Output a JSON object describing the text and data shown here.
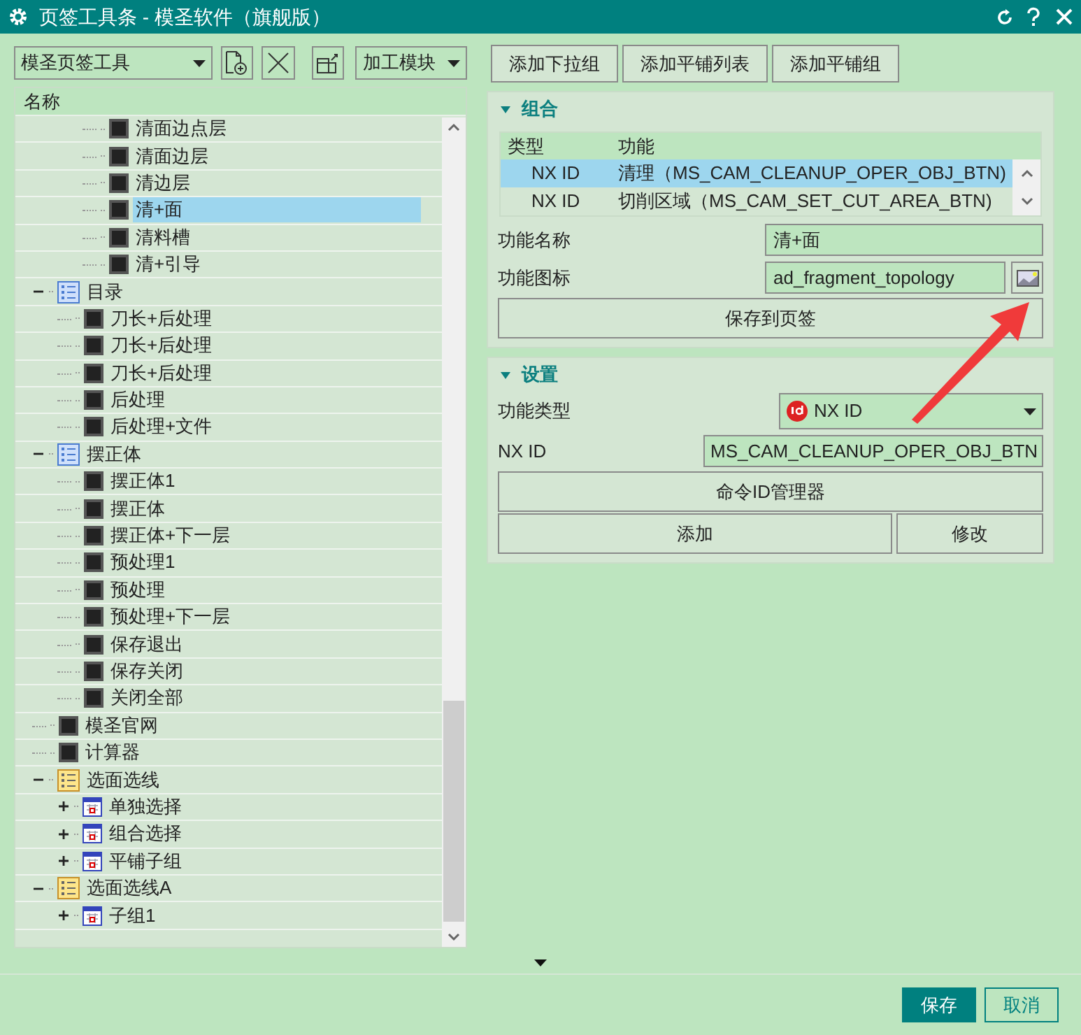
{
  "window": {
    "title": "页签工具条 - 模圣软件（旗舰版）"
  },
  "toolbar": {
    "tab_select": "模圣页签工具",
    "module_select": "加工模块"
  },
  "tree": {
    "column": "名称",
    "partial_branch": [
      {
        "label": "清面边点层",
        "kind": "command",
        "selected": false
      },
      {
        "label": "清面边层",
        "kind": "command",
        "selected": false
      },
      {
        "label": "清边层",
        "kind": "command",
        "selected": false
      },
      {
        "label": "清+面",
        "kind": "command",
        "selected": true
      },
      {
        "label": "清料槽",
        "kind": "command",
        "selected": false
      },
      {
        "label": "清+引导",
        "kind": "command",
        "selected": false
      }
    ],
    "nodes": [
      {
        "label": "目录",
        "kind": "folder",
        "expanded": true,
        "selected": false,
        "children": [
          {
            "label": "刀长+后处理",
            "kind": "command",
            "selected": false
          },
          {
            "label": "刀长+后处理",
            "kind": "command",
            "selected": false
          },
          {
            "label": "刀长+后处理",
            "kind": "command",
            "selected": false
          },
          {
            "label": "后处理",
            "kind": "command",
            "selected": false
          },
          {
            "label": "后处理+文件",
            "kind": "command",
            "selected": false
          }
        ]
      },
      {
        "label": "摆正体",
        "kind": "folder",
        "expanded": true,
        "selected": false,
        "children": [
          {
            "label": "摆正体1",
            "kind": "command",
            "selected": false
          },
          {
            "label": "摆正体",
            "kind": "command",
            "selected": false
          },
          {
            "label": "摆正体+下一层",
            "kind": "command",
            "selected": false
          },
          {
            "label": "预处理1",
            "kind": "command",
            "selected": false
          },
          {
            "label": "预处理",
            "kind": "command",
            "selected": false
          },
          {
            "label": "预处理+下一层",
            "kind": "command",
            "selected": false
          },
          {
            "label": "保存退出",
            "kind": "command",
            "selected": false
          },
          {
            "label": "保存关闭",
            "kind": "command",
            "selected": false
          },
          {
            "label": "关闭全部",
            "kind": "command",
            "selected": false
          }
        ]
      },
      {
        "label": "模圣官网",
        "kind": "command",
        "selected": false
      },
      {
        "label": "计算器",
        "kind": "command",
        "selected": false
      },
      {
        "label": "选面选线",
        "kind": "group",
        "expanded": true,
        "selected": false,
        "children": [
          {
            "label": "单独选择",
            "kind": "subgroup",
            "expanded": false,
            "selected": false
          },
          {
            "label": "组合选择",
            "kind": "subgroup",
            "expanded": false,
            "selected": false
          },
          {
            "label": "平铺子组",
            "kind": "subgroup",
            "expanded": false,
            "selected": false
          }
        ]
      },
      {
        "label": "选面选线A",
        "kind": "group",
        "expanded": true,
        "selected": false,
        "children": [
          {
            "label": "子组1",
            "kind": "subgroup",
            "expanded": false,
            "selected": false
          }
        ]
      }
    ]
  },
  "add_buttons": [
    "添加下拉组",
    "添加平铺列表",
    "添加平铺组"
  ],
  "combo": {
    "title": "组合",
    "expanded": true,
    "columns": [
      "类型",
      "功能"
    ],
    "rows": [
      {
        "type": "NX ID",
        "function": "清理（MS_CAM_CLEANUP_OPER_OBJ_BTN)",
        "selected": true
      },
      {
        "type": "NX ID",
        "function": "切削区域（MS_CAM_SET_CUT_AREA_BTN)",
        "selected": false
      }
    ],
    "name_label": "功能名称",
    "name_value": "清+面",
    "icon_label": "功能图标",
    "icon_value": "ad_fragment_topology",
    "save_button": "保存到页签"
  },
  "settings": {
    "title": "设置",
    "expanded": true,
    "type_label": "功能类型",
    "type_value": "NX ID",
    "id_label": "NX ID",
    "id_value": "MS_CAM_CLEANUP_OPER_OBJ_BTN",
    "manager_button": "命令ID管理器",
    "add_button": "添加",
    "modify_button": "修改"
  },
  "footer": {
    "save": "保存",
    "cancel": "取消"
  }
}
